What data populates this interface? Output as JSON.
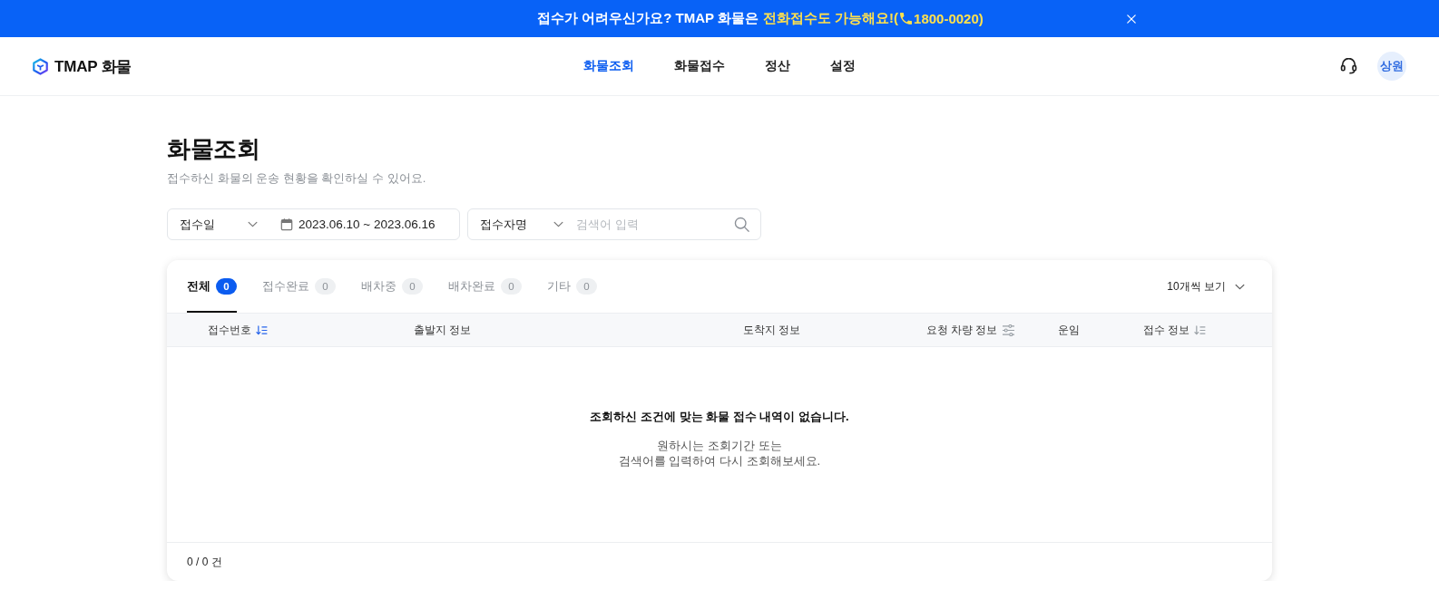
{
  "banner": {
    "text": "접수가 어려우신가요? TMAP 화물은",
    "highlight": "전화접수도 가능해요!(",
    "phone": "1800-0020)"
  },
  "header": {
    "logo_text": "TMAP 화물",
    "nav": [
      {
        "label": "화물조회",
        "selected": true
      },
      {
        "label": "화물접수",
        "selected": false
      },
      {
        "label": "정산",
        "selected": false
      },
      {
        "label": "설정",
        "selected": false
      }
    ],
    "avatar": "상원"
  },
  "page": {
    "title": "화물조회",
    "subtitle": "접수하신 화물의 운송 현황을 확인하실 수 있어요."
  },
  "filters": {
    "date_type": "접수일",
    "date_range": "2023.06.10 ~ 2023.06.16",
    "search_type": "접수자명",
    "search": {
      "placeholder": "검색어 입력"
    }
  },
  "results": {
    "tabs": [
      {
        "label": "전체",
        "count": "0",
        "selected": true
      },
      {
        "label": "접수완료",
        "count": "0",
        "selected": false
      },
      {
        "label": "배차중",
        "count": "0",
        "selected": false
      },
      {
        "label": "배차완료",
        "count": "0",
        "selected": false
      },
      {
        "label": "기타",
        "count": "0",
        "selected": false
      }
    ],
    "page_size": "10개씩 보기",
    "columns": [
      {
        "label": "접수번호",
        "kind": "sort",
        "active": true
      },
      {
        "label": "출발지 정보",
        "kind": "plain"
      },
      {
        "label": "도착지 정보",
        "kind": "plain"
      },
      {
        "label": "요청 차량 정보",
        "kind": "filter"
      },
      {
        "label": "운임",
        "kind": "plain"
      },
      {
        "label": "접수 정보",
        "kind": "sort",
        "active": false
      }
    ],
    "empty_state": {
      "title": "조회하신 조건에 맞는 화물 접수 내역이 없습니다.",
      "message": "원하시는 조회기간 또는\n검색어를 입력하여 다시 조회해보세요."
    },
    "total": "0 / 0 건"
  }
}
